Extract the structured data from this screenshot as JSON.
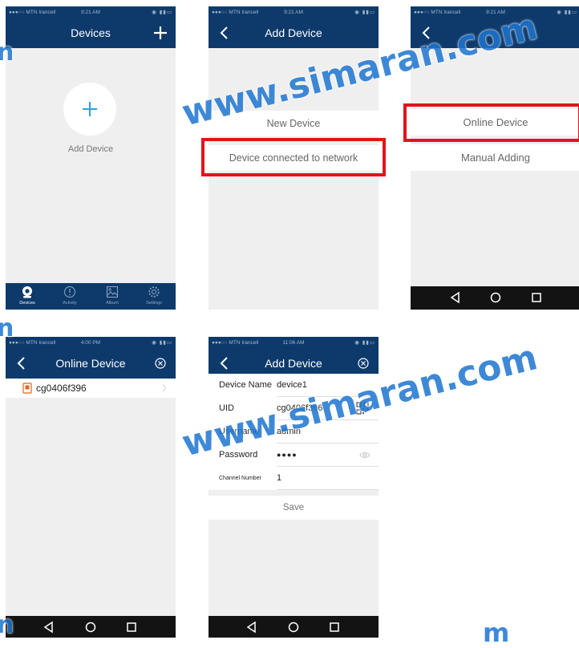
{
  "status": {
    "carrier": "●●●○○ MTN Irancell",
    "time_a": "9:21 AM",
    "time_b": "4:00 PM",
    "time_c": "11:06 AM"
  },
  "screen1": {
    "title": "Devices",
    "add_device_label": "Add Device",
    "tabs": [
      {
        "label": "Devices",
        "icon": "camera-icon"
      },
      {
        "label": "Activity",
        "icon": "alert-icon"
      },
      {
        "label": "Album",
        "icon": "image-icon"
      },
      {
        "label": "Settings",
        "icon": "gear-icon"
      }
    ]
  },
  "screen2": {
    "title": "Add Device",
    "option_new": "New Device",
    "option_connected": "Device connected to network"
  },
  "screen3": {
    "option_online": "Online Device",
    "option_manual": "Manual Adding"
  },
  "screen4": {
    "title": "Online Device",
    "device_uid": "cg0406f396"
  },
  "screen5": {
    "title": "Add Device",
    "fields": [
      {
        "label": "Device Name",
        "value": "device1"
      },
      {
        "label": "UID",
        "value": "cg0406f396"
      },
      {
        "label": "Username",
        "value": "admin"
      },
      {
        "label": "Password",
        "value": "●●●●"
      },
      {
        "label": "Channel Number",
        "value": "1"
      }
    ],
    "save_label": "Save"
  },
  "watermark": {
    "text_main": "www.simaran.com",
    "text_fragment_left": "n",
    "text_fragment_bottom": "m"
  },
  "colors": {
    "navbar": "#0e3a6b",
    "accent": "#2aa3e0",
    "highlight": "#e3131b",
    "watermark": "#1d75d1"
  }
}
